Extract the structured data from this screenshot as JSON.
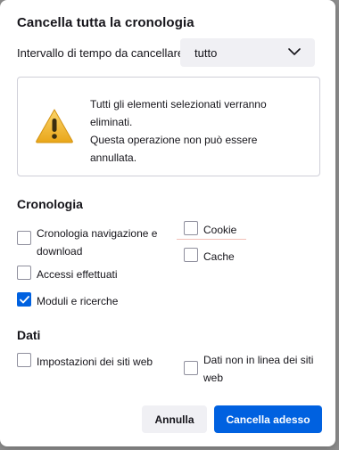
{
  "dialog": {
    "title": "Cancella tutta la cronologia"
  },
  "time_range": {
    "label": "Intervallo di tempo da cancellare:",
    "selected": "tutto"
  },
  "warning": {
    "icon": "warning-triangle-icon",
    "lines": [
      "Tutti gli elementi selezionati verranno",
      "eliminati.",
      "Questa operazione non può essere",
      "annullata."
    ]
  },
  "history_section": {
    "title": "Cronologia",
    "items": [
      {
        "label": "Cronologia navigazione e download",
        "checked": false
      },
      {
        "label": "Cookie",
        "checked": false
      },
      {
        "label": "Accessi effettuati",
        "checked": false
      },
      {
        "label": "Cache",
        "checked": false
      },
      {
        "label": "Moduli e ricerche",
        "checked": true
      }
    ]
  },
  "data_section": {
    "title": "Dati",
    "items": [
      {
        "label": "Impostazioni dei siti web",
        "checked": false
      },
      {
        "label": "Dati non in linea dei siti web",
        "checked": false
      }
    ]
  },
  "buttons": {
    "cancel": "Annulla",
    "confirm": "Cancella adesso"
  },
  "colors": {
    "accent": "#0061e0",
    "warning_icon": "#f0b429"
  }
}
